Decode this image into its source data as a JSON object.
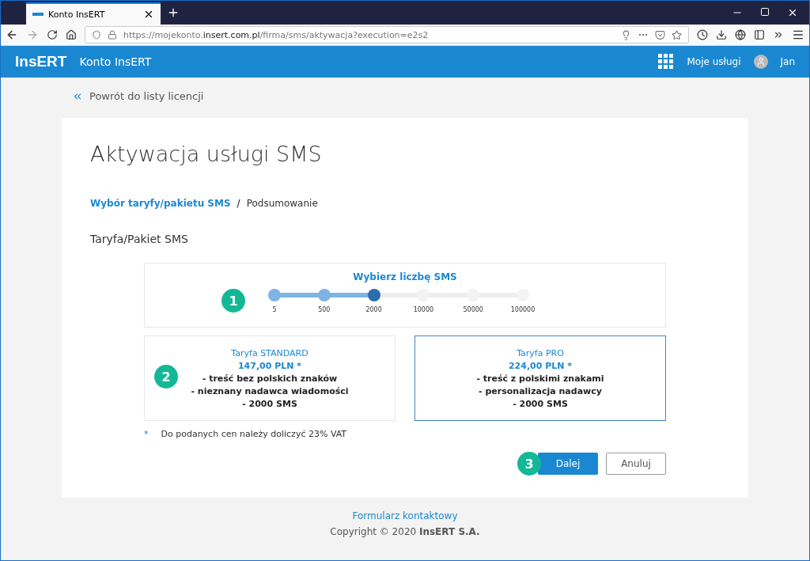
{
  "browser": {
    "tab_title": "Konto InsERT",
    "url_prefix": "https://mojekonto.",
    "url_domain": "insert.com.pl",
    "url_path": "/firma/sms/aktywacja?execution=e2s2"
  },
  "header": {
    "logo": "InsERT",
    "title": "Konto InsERT",
    "services": "Moje usługi",
    "user": "Jan"
  },
  "back_link": "Powrót do listy licencji",
  "page_title": "Aktywacja usługi SMS",
  "breadcrumb": [
    {
      "label": "Wybór taryfy/pakietu SMS",
      "link": true
    },
    {
      "label": "Podsumowanie",
      "link": false
    }
  ],
  "breadcrumb_separator": "/",
  "section_title": "Taryfa/Pakiet SMS",
  "slider": {
    "title": "Wybierz liczbę SMS",
    "badge": "1",
    "steps": [
      {
        "label": "5",
        "selected": false
      },
      {
        "label": "500",
        "selected": false
      },
      {
        "label": "2000",
        "selected": true
      },
      {
        "label": "10000",
        "selected": false
      },
      {
        "label": "50000",
        "selected": false
      },
      {
        "label": "100000",
        "selected": false
      }
    ]
  },
  "plans_badge": "2",
  "plans": [
    {
      "name": "Taryfa STANDARD",
      "price": "147,00 PLN *",
      "features": [
        "- treść bez polskich znaków",
        "- nieznany nadawca wiadomości",
        "- 2000 SMS"
      ],
      "selected": false
    },
    {
      "name": "Taryfa PRO",
      "price": "224,00 PLN *",
      "features": [
        "- treść z polskimi znakami",
        "- personalizacja nadawcy",
        "- 2000 SMS"
      ],
      "selected": true
    }
  ],
  "footnote": {
    "mark": "*",
    "text": "Do podanych cen należy doliczyć 23% VAT"
  },
  "actions_badge": "3",
  "buttons": [
    {
      "label": "Dalej",
      "kind": "primary"
    },
    {
      "label": "Anuluj",
      "kind": "secondary"
    }
  ],
  "footer": {
    "link": "Formularz kontaktowy",
    "copyright": "Copyright © 2020 **InsERT S.A.**"
  }
}
